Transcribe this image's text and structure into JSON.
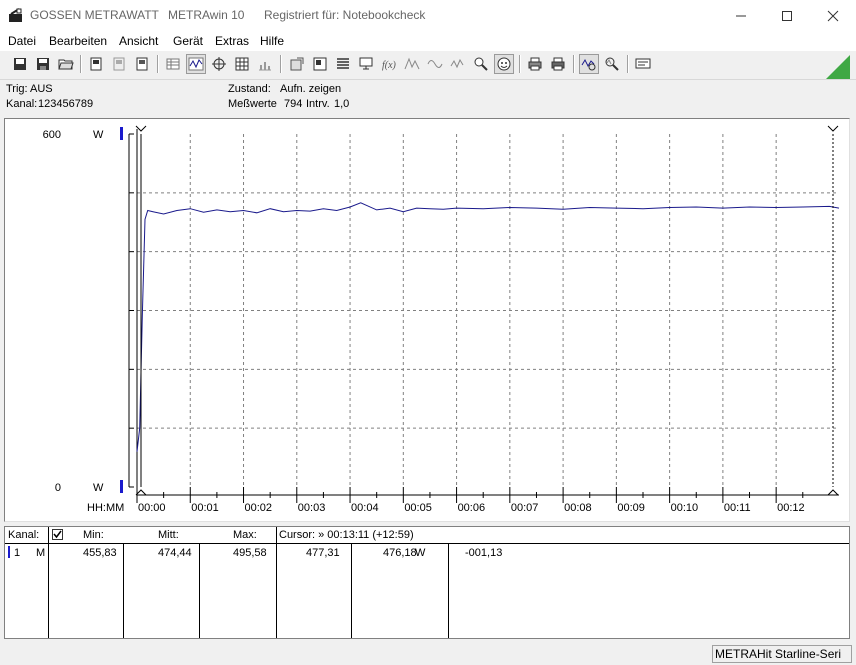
{
  "window": {
    "company": "GOSSEN METRAWATT",
    "product": "METRAwin 10",
    "registered": "Registriert für: Notebookcheck"
  },
  "menu": [
    "Datei",
    "Bearbeiten",
    "Ansicht",
    "Gerät",
    "Extras",
    "Hilfe"
  ],
  "toolbar_icons": [
    "new-icon",
    "save-icon",
    "open-folder-icon",
    "device-icon",
    "device-disabled-icon",
    "device-icon",
    "table-icon",
    "waveform-icon",
    "crosshair-icon",
    "grid-table-icon",
    "bar-chart-icon",
    "export-icon",
    "print-preview-icon",
    "settings-table-icon",
    "computer-icon",
    "fx-icon",
    "peak-icon",
    "sine-icon",
    "search-filter-icon",
    "smiley-icon",
    "printer-icon",
    "printer-alt-icon",
    "zoom-waveform-icon",
    "zoom-icon",
    "message-icon"
  ],
  "status": {
    "trig_label": "Trig:",
    "trig_value": "AUS",
    "kanal_label": "Kanal:",
    "kanal_value": "123456789",
    "zustand_label": "Zustand:",
    "zustand_value": "Aufn. zeigen",
    "messwerte_label": "Meßwerte",
    "messwerte_value": "794",
    "intrv_label": "Intrv.",
    "intrv_value": "1,0"
  },
  "chart_data": {
    "type": "line",
    "y_top_label": "600",
    "y_bottom_label": "0",
    "y_unit": "W",
    "x_axis_label": "HH:MM",
    "ylim": [
      0,
      600
    ],
    "x_ticks": [
      "00:00",
      "00:01",
      "00:02",
      "00:03",
      "00:04",
      "00:05",
      "00:06",
      "00:07",
      "00:08",
      "00:09",
      "00:10",
      "00:11",
      "00:12"
    ],
    "xlim_minutes": [
      0,
      13.18
    ],
    "grid": true,
    "series": [
      {
        "color": "#1a1a8c",
        "x_minutes": [
          0,
          0.05,
          0.1,
          0.15,
          0.2,
          0.3,
          0.5,
          0.75,
          1,
          1.25,
          1.5,
          1.75,
          2,
          2.25,
          2.5,
          2.75,
          3,
          3.25,
          3.5,
          3.75,
          4,
          4.2,
          4.5,
          4.75,
          5,
          5.25,
          5.5,
          5.75,
          6,
          6.5,
          7,
          7.5,
          8,
          8.5,
          9,
          9.5,
          10,
          10.5,
          11,
          11.5,
          12,
          12.5,
          13,
          13.18
        ],
        "watts": [
          60,
          100,
          290,
          455,
          470,
          468,
          464,
          470,
          473,
          467,
          471,
          468,
          470,
          466,
          473,
          468,
          470,
          469,
          473,
          470,
          476,
          483,
          471,
          474,
          468,
          474,
          473,
          472,
          474,
          473,
          475,
          474,
          472,
          475,
          474,
          473,
          475,
          476,
          474,
          476,
          475,
          476,
          477,
          474
        ]
      }
    ]
  },
  "table": {
    "headers": {
      "kanal": "Kanal:",
      "min": "Min:",
      "mitt": "Mitt:",
      "max": "Max:",
      "cursor": "Cursor: » 00:13:11 (+12:59)"
    },
    "rows": [
      {
        "channel": "1",
        "mode": "M",
        "min": "455,83",
        "mitt": "474,44",
        "max": "495,58",
        "cursor_value": "477,31",
        "value2": "476,18",
        "unit": "W",
        "delta": "-001,13"
      }
    ]
  },
  "statusbar": {
    "device": "METRAHit Starline-Seri"
  },
  "colors": {
    "trace": "#1a1a8c",
    "marker": "#1a1acc",
    "grid": "#808080"
  }
}
